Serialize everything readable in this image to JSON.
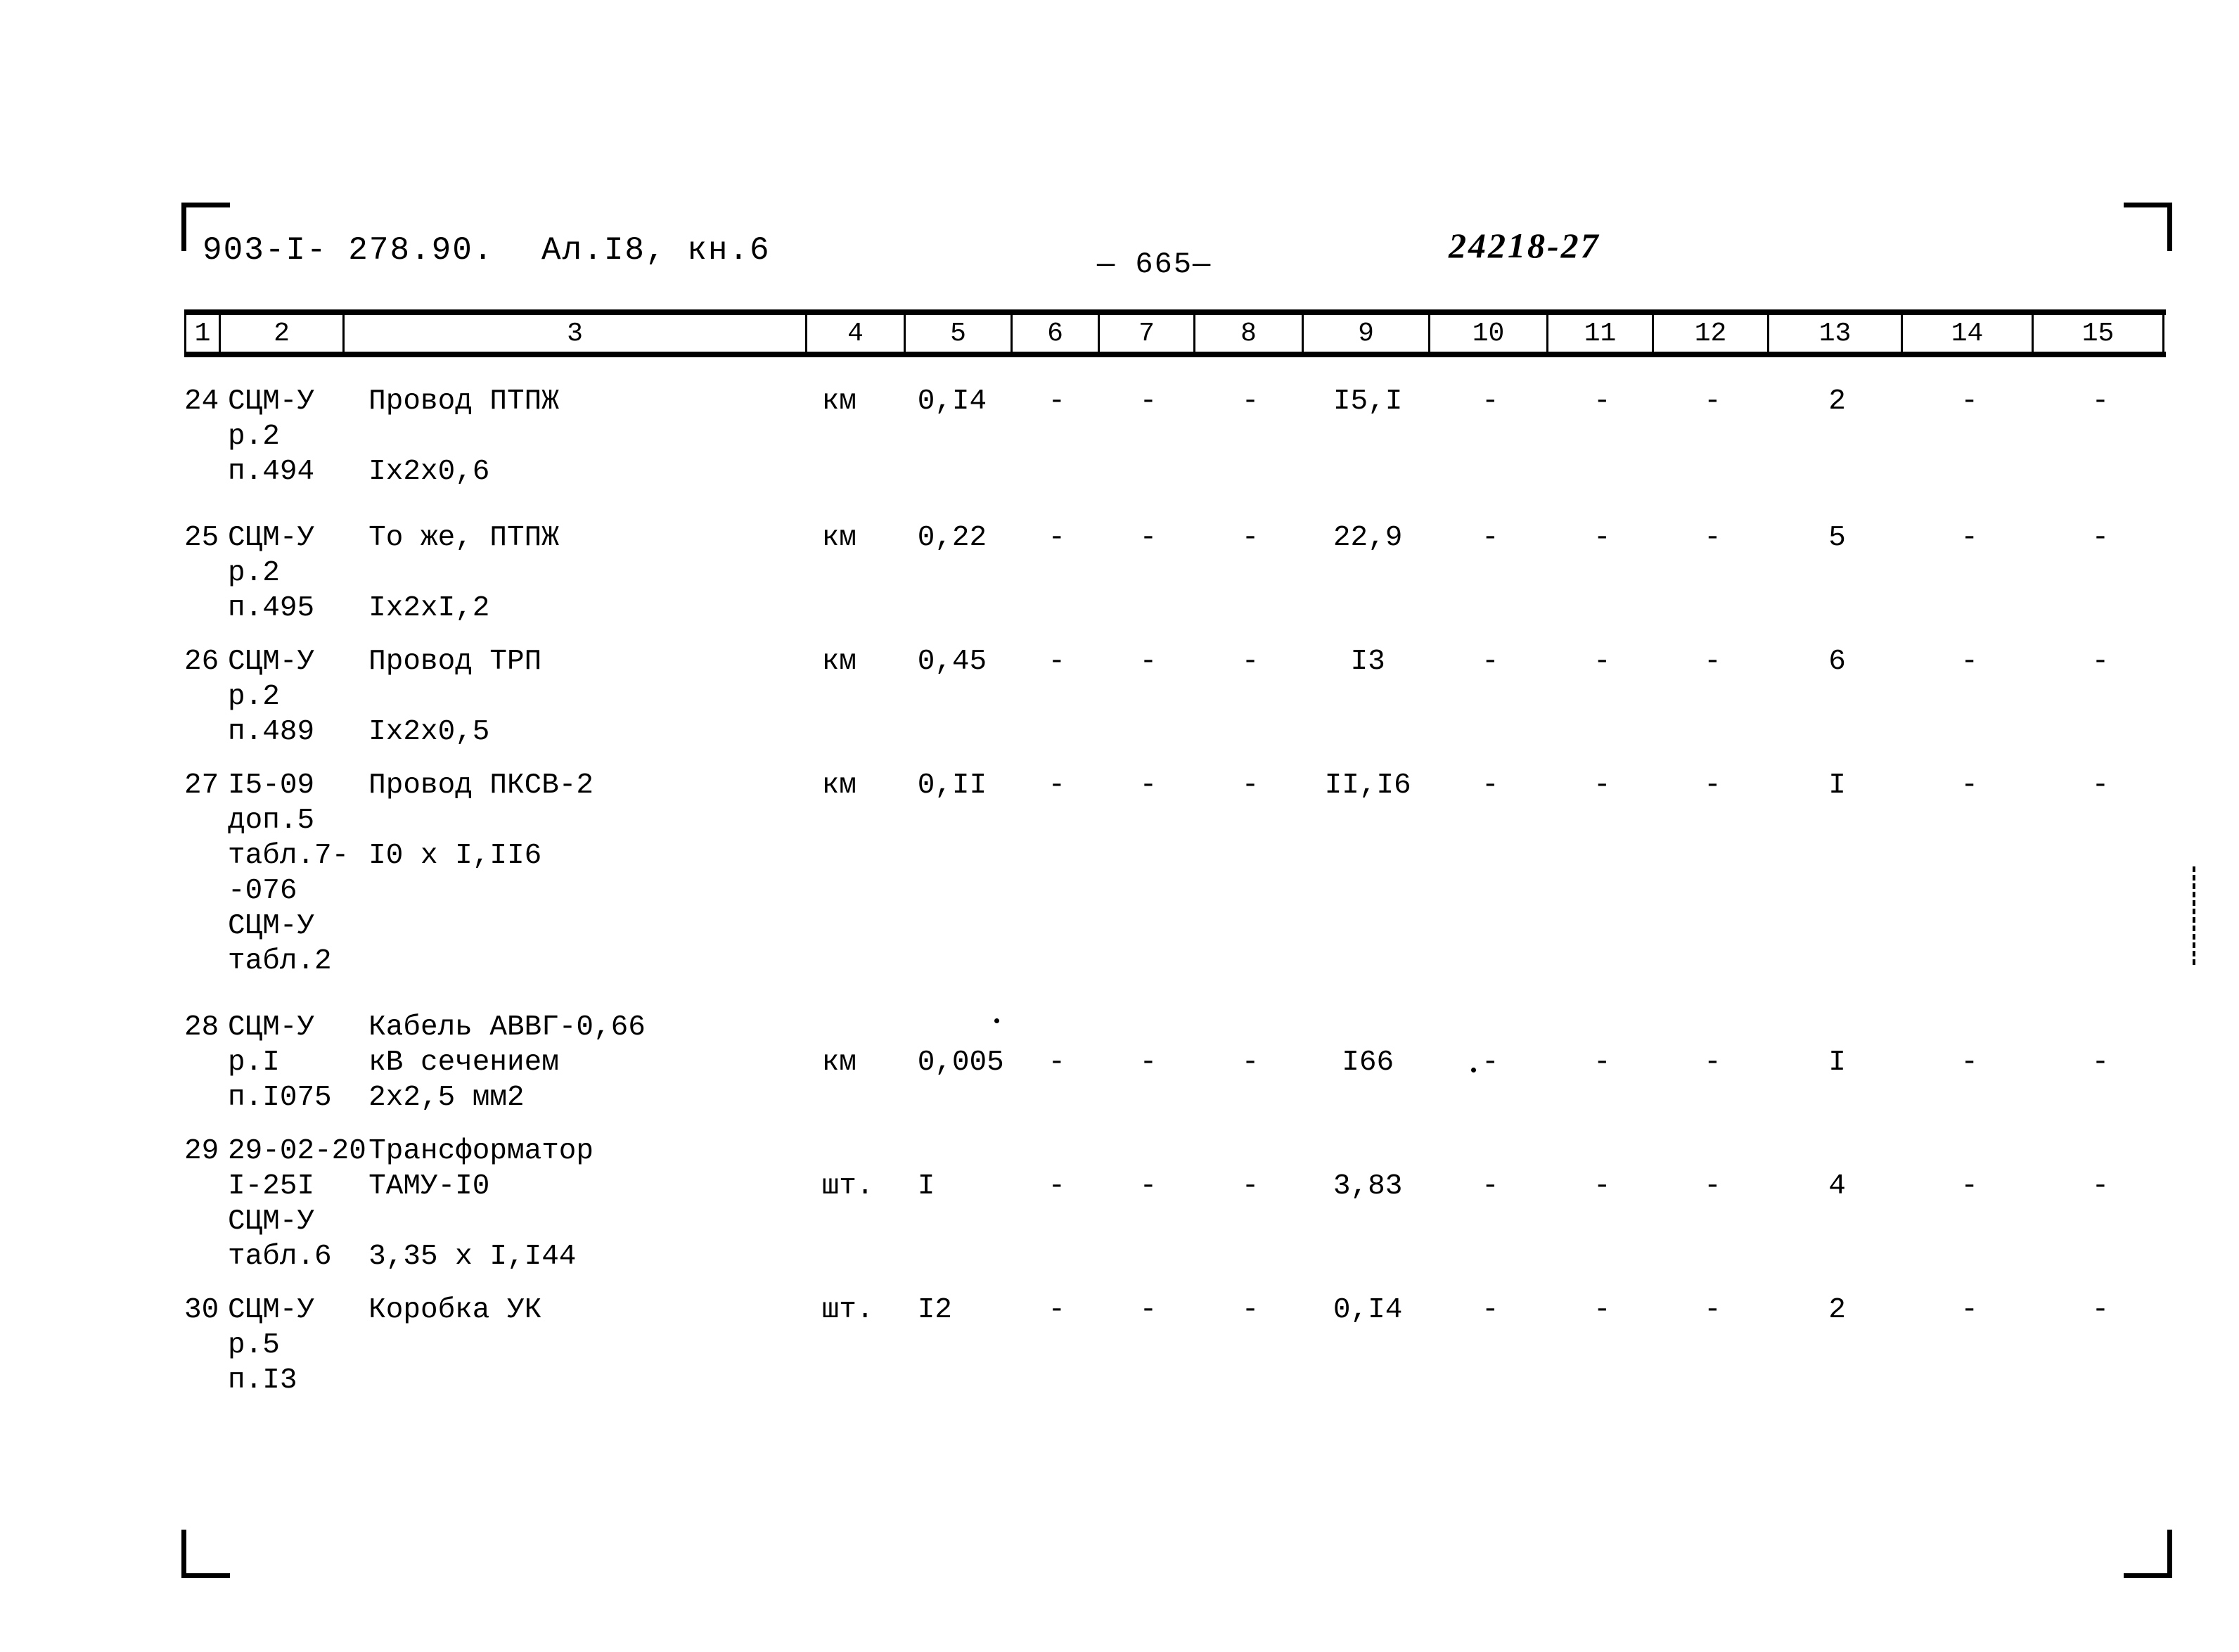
{
  "header": {
    "doc_code": "903-I- 278.90.",
    "album": "Ал.I8, кн.6",
    "page_number": "665",
    "archive_number": "24218-27"
  },
  "table": {
    "column_numbers": [
      "1",
      "2",
      "3",
      "4",
      "5",
      "6",
      "7",
      "8",
      "9",
      "10",
      "11",
      "12",
      "13",
      "14",
      "15"
    ],
    "rows": [
      {
        "no": "24",
        "code_lines": [
          "СЦМ-У",
          "р.2",
          "п.494"
        ],
        "name_lines": [
          "Провод ПТПЖ",
          "",
          "Iх2х0,6"
        ],
        "unit": "км",
        "c5": "0,I4",
        "c6": "-",
        "c7": "-",
        "c8": "-",
        "c9": "I5,I",
        "c10": "-",
        "c11": "-",
        "c12": "-",
        "c13": "2",
        "c14": "-",
        "c15": "-"
      },
      {
        "no": "25",
        "code_lines": [
          "СЦМ-У",
          "р.2",
          "п.495"
        ],
        "name_lines": [
          "То же, ПТПЖ",
          "",
          "Iх2хI,2"
        ],
        "unit": "км",
        "c5": "0,22",
        "c6": "-",
        "c7": "-",
        "c8": "-",
        "c9": "22,9",
        "c10": "-",
        "c11": "-",
        "c12": "-",
        "c13": "5",
        "c14": "-",
        "c15": "-"
      },
      {
        "no": "26",
        "code_lines": [
          "СЦМ-У",
          "р.2",
          "п.489"
        ],
        "name_lines": [
          "Провод ТРП",
          "",
          "Iх2х0,5"
        ],
        "unit": "км",
        "c5": "0,45",
        "c6": "-",
        "c7": "-",
        "c8": "-",
        "c9": "I3",
        "c10": "-",
        "c11": "-",
        "c12": "-",
        "c13": "6",
        "c14": "-",
        "c15": "-"
      },
      {
        "no": "27",
        "code_lines": [
          "I5-09",
          "доп.5",
          "табл.7-",
          "-076",
          "СЦМ-У",
          "табл.2"
        ],
        "name_lines": [
          "Провод ПКСВ-2",
          "",
          "I0 х I,II6"
        ],
        "unit": "км",
        "c5": "0,II",
        "c6": "-",
        "c7": "-",
        "c8": "-",
        "c9": "II,I6",
        "c10": "-",
        "c11": "-",
        "c12": "-",
        "c13": "I",
        "c14": "-",
        "c15": "-"
      },
      {
        "no": "28",
        "code_lines": [
          "СЦМ-У",
          "р.I",
          "п.I075"
        ],
        "name_lines": [
          "Кабель АВВГ-0,66",
          "кВ сечением",
          "2х2,5 мм2"
        ],
        "unit": "км",
        "c5": "0,005",
        "c6": "-",
        "c7": "-",
        "c8": "-",
        "c9": "I66",
        "c10": "-",
        "c11": "-",
        "c12": "-",
        "c13": "I",
        "c14": "-",
        "c15": "-"
      },
      {
        "no": "29",
        "code_lines": [
          "29-02-20",
          "I-25I",
          "СЦМ-У",
          "табл.6"
        ],
        "name_lines": [
          "Трансформатор",
          "ТАМУ-I0",
          "",
          "3,35 х I,I44"
        ],
        "unit": "шт.",
        "c5": "I",
        "c6": "-",
        "c7": "-",
        "c8": "-",
        "c9": "3,83",
        "c10": "-",
        "c11": "-",
        "c12": "-",
        "c13": "4",
        "c14": "-",
        "c15": "-"
      },
      {
        "no": "30",
        "code_lines": [
          "СЦМ-У",
          "р.5",
          "п.I3"
        ],
        "name_lines": [
          "Коробка УК",
          "",
          ""
        ],
        "unit": "шт.",
        "c5": "I2",
        "c6": "-",
        "c7": "-",
        "c8": "-",
        "c9": "0,I4",
        "c10": "-",
        "c11": "-",
        "c12": "-",
        "c13": "2",
        "c14": "-",
        "c15": "-"
      }
    ]
  }
}
